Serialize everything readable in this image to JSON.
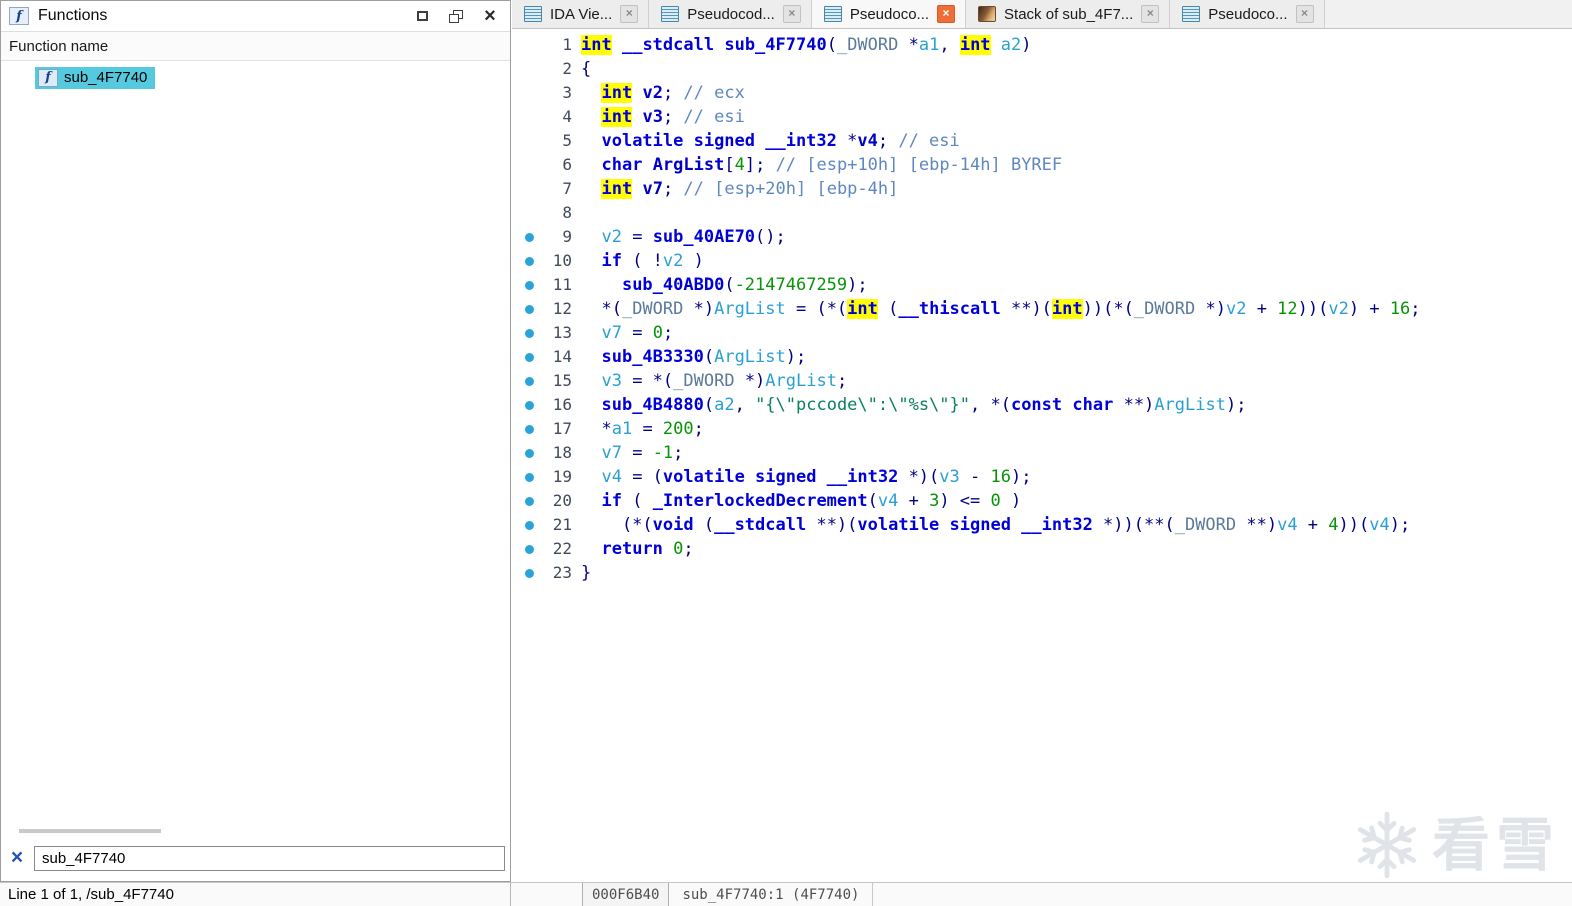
{
  "functions_panel": {
    "title": "Functions",
    "column_header": "Function name",
    "items": [
      {
        "label": "sub_4F7740",
        "selected": true
      }
    ],
    "filter": {
      "value": "sub_4F7740"
    },
    "status": "Line 1 of 1, /sub_4F7740"
  },
  "tabs": [
    {
      "label": "IDA Vie...",
      "active": false,
      "icon": "ida-view-icon"
    },
    {
      "label": "Pseudocod...",
      "active": false,
      "icon": "pseudocode-icon"
    },
    {
      "label": "Pseudoco...",
      "active": true,
      "icon": "pseudocode-icon"
    },
    {
      "label": "Stack of sub_4F7...",
      "active": false,
      "icon": "stack-view-icon"
    },
    {
      "label": "Pseudoco...",
      "active": false,
      "icon": "pseudocode-icon"
    }
  ],
  "status_bar": {
    "address": "000F6B40",
    "location": "sub_4F7740:1 (4F7740)"
  },
  "watermark": {
    "text": "看雪"
  },
  "icons": {
    "function_glyph": "f",
    "close_glyph": "×",
    "clear_filter_glyph": "×"
  },
  "colors": {
    "selection_cyan": "#55cadf",
    "highlight_yellow": "#ffff00",
    "active_close_orange": "#ee6e38",
    "marker_blue": "#2aa3d7",
    "syntax_plain": "#000080",
    "syntax_keyword": "#0000d8",
    "syntax_type": "#5a7a9a",
    "syntax_variable": "#2aa0d0",
    "syntax_declaration": "#0000c8",
    "syntax_function": "#0000d8",
    "syntax_number": "#089408",
    "syntax_string": "#0a8060",
    "syntax_comment": "#5f87c0"
  },
  "code": {
    "lines": [
      {
        "n": 1,
        "m": false,
        "t": [
          [
            "kw",
            "int",
            1
          ],
          [
            "pl",
            " "
          ],
          [
            "kw",
            "__stdcall"
          ],
          [
            "pl",
            " "
          ],
          [
            "fn",
            "sub_4F7740"
          ],
          [
            "pl",
            "("
          ],
          [
            "typ",
            "_DWORD"
          ],
          [
            "pl",
            " *"
          ],
          [
            "var",
            "a1"
          ],
          [
            "pl",
            ", "
          ],
          [
            "kw",
            "int",
            1
          ],
          [
            "pl",
            " "
          ],
          [
            "var",
            "a2"
          ],
          [
            "pl",
            ")"
          ]
        ]
      },
      {
        "n": 2,
        "m": false,
        "t": [
          [
            "pl",
            "{"
          ]
        ]
      },
      {
        "n": 3,
        "m": false,
        "t": [
          [
            "pl",
            "  "
          ],
          [
            "kw",
            "int",
            1
          ],
          [
            "pl",
            " "
          ],
          [
            "decl",
            "v2"
          ],
          [
            "pl",
            "; "
          ],
          [
            "com",
            "// ecx"
          ]
        ]
      },
      {
        "n": 4,
        "m": false,
        "t": [
          [
            "pl",
            "  "
          ],
          [
            "kw",
            "int",
            1
          ],
          [
            "pl",
            " "
          ],
          [
            "decl",
            "v3"
          ],
          [
            "pl",
            "; "
          ],
          [
            "com",
            "// esi"
          ]
        ]
      },
      {
        "n": 5,
        "m": false,
        "t": [
          [
            "pl",
            "  "
          ],
          [
            "kw",
            "volatile signed __int32"
          ],
          [
            "pl",
            " *"
          ],
          [
            "decl",
            "v4"
          ],
          [
            "pl",
            "; "
          ],
          [
            "com",
            "// esi"
          ]
        ]
      },
      {
        "n": 6,
        "m": false,
        "t": [
          [
            "pl",
            "  "
          ],
          [
            "kw",
            "char"
          ],
          [
            "pl",
            " "
          ],
          [
            "decl",
            "ArgList"
          ],
          [
            "pl",
            "["
          ],
          [
            "num",
            "4"
          ],
          [
            "pl",
            "]; "
          ],
          [
            "com",
            "// [esp+10h] [ebp-14h] BYREF"
          ]
        ]
      },
      {
        "n": 7,
        "m": false,
        "t": [
          [
            "pl",
            "  "
          ],
          [
            "kw",
            "int",
            1
          ],
          [
            "pl",
            " "
          ],
          [
            "decl",
            "v7"
          ],
          [
            "pl",
            "; "
          ],
          [
            "com",
            "// [esp+20h] [ebp-4h]"
          ]
        ]
      },
      {
        "n": 8,
        "m": false,
        "t": []
      },
      {
        "n": 9,
        "m": true,
        "t": [
          [
            "pl",
            "  "
          ],
          [
            "var",
            "v2"
          ],
          [
            "pl",
            " = "
          ],
          [
            "fn",
            "sub_40AE70"
          ],
          [
            "pl",
            "();"
          ]
        ]
      },
      {
        "n": 10,
        "m": true,
        "t": [
          [
            "pl",
            "  "
          ],
          [
            "kw",
            "if"
          ],
          [
            "pl",
            " ( !"
          ],
          [
            "var",
            "v2"
          ],
          [
            "pl",
            " )"
          ]
        ]
      },
      {
        "n": 11,
        "m": true,
        "t": [
          [
            "pl",
            "    "
          ],
          [
            "fn",
            "sub_40ABD0"
          ],
          [
            "pl",
            "("
          ],
          [
            "num",
            "-2147467259"
          ],
          [
            "pl",
            ");"
          ]
        ]
      },
      {
        "n": 12,
        "m": true,
        "t": [
          [
            "pl",
            "  *("
          ],
          [
            "typ",
            "_DWORD"
          ],
          [
            "pl",
            " *)"
          ],
          [
            "var",
            "ArgList"
          ],
          [
            "pl",
            " = (*("
          ],
          [
            "kw",
            "int",
            1
          ],
          [
            "pl",
            " ("
          ],
          [
            "kw",
            "__thiscall"
          ],
          [
            "pl",
            " **)("
          ],
          [
            "kw",
            "int",
            1
          ],
          [
            "pl",
            "))(*("
          ],
          [
            "typ",
            "_DWORD"
          ],
          [
            "pl",
            " *)"
          ],
          [
            "var",
            "v2"
          ],
          [
            "pl",
            " + "
          ],
          [
            "num",
            "12"
          ],
          [
            "pl",
            "))("
          ],
          [
            "var",
            "v2"
          ],
          [
            "pl",
            ") + "
          ],
          [
            "num",
            "16"
          ],
          [
            "pl",
            ";"
          ]
        ]
      },
      {
        "n": 13,
        "m": true,
        "t": [
          [
            "pl",
            "  "
          ],
          [
            "var",
            "v7"
          ],
          [
            "pl",
            " = "
          ],
          [
            "num",
            "0"
          ],
          [
            "pl",
            ";"
          ]
        ]
      },
      {
        "n": 14,
        "m": true,
        "t": [
          [
            "pl",
            "  "
          ],
          [
            "fn",
            "sub_4B3330"
          ],
          [
            "pl",
            "("
          ],
          [
            "var",
            "ArgList"
          ],
          [
            "pl",
            ");"
          ]
        ]
      },
      {
        "n": 15,
        "m": true,
        "t": [
          [
            "pl",
            "  "
          ],
          [
            "var",
            "v3"
          ],
          [
            "pl",
            " = *("
          ],
          [
            "typ",
            "_DWORD"
          ],
          [
            "pl",
            " *)"
          ],
          [
            "var",
            "ArgList"
          ],
          [
            "pl",
            ";"
          ]
        ]
      },
      {
        "n": 16,
        "m": true,
        "t": [
          [
            "pl",
            "  "
          ],
          [
            "fn",
            "sub_4B4880"
          ],
          [
            "pl",
            "("
          ],
          [
            "var",
            "a2"
          ],
          [
            "pl",
            ", "
          ],
          [
            "str",
            "\"{\\\"pccode\\\":\\\"%s\\\"}\""
          ],
          [
            "pl",
            ", *("
          ],
          [
            "kw",
            "const"
          ],
          [
            "pl",
            " "
          ],
          [
            "kw",
            "char"
          ],
          [
            "pl",
            " **)"
          ],
          [
            "var",
            "ArgList"
          ],
          [
            "pl",
            ");"
          ]
        ]
      },
      {
        "n": 17,
        "m": true,
        "t": [
          [
            "pl",
            "  *"
          ],
          [
            "var",
            "a1"
          ],
          [
            "pl",
            " = "
          ],
          [
            "num",
            "200"
          ],
          [
            "pl",
            ";"
          ]
        ]
      },
      {
        "n": 18,
        "m": true,
        "t": [
          [
            "pl",
            "  "
          ],
          [
            "var",
            "v7"
          ],
          [
            "pl",
            " = "
          ],
          [
            "num",
            "-1"
          ],
          [
            "pl",
            ";"
          ]
        ]
      },
      {
        "n": 19,
        "m": true,
        "t": [
          [
            "pl",
            "  "
          ],
          [
            "var",
            "v4"
          ],
          [
            "pl",
            " = ("
          ],
          [
            "kw",
            "volatile signed __int32"
          ],
          [
            "pl",
            " *)("
          ],
          [
            "var",
            "v3"
          ],
          [
            "pl",
            " - "
          ],
          [
            "num",
            "16"
          ],
          [
            "pl",
            ");"
          ]
        ]
      },
      {
        "n": 20,
        "m": true,
        "t": [
          [
            "pl",
            "  "
          ],
          [
            "kw",
            "if"
          ],
          [
            "pl",
            " ( "
          ],
          [
            "fn",
            "_InterlockedDecrement"
          ],
          [
            "pl",
            "("
          ],
          [
            "var",
            "v4"
          ],
          [
            "pl",
            " + "
          ],
          [
            "num",
            "3"
          ],
          [
            "pl",
            ") <= "
          ],
          [
            "num",
            "0"
          ],
          [
            "pl",
            " )"
          ]
        ]
      },
      {
        "n": 21,
        "m": true,
        "t": [
          [
            "pl",
            "    (*("
          ],
          [
            "kw",
            "void"
          ],
          [
            "pl",
            " ("
          ],
          [
            "kw",
            "__stdcall"
          ],
          [
            "pl",
            " **)("
          ],
          [
            "kw",
            "volatile signed __int32"
          ],
          [
            "pl",
            " *))(**("
          ],
          [
            "typ",
            "_DWORD"
          ],
          [
            "pl",
            " **)"
          ],
          [
            "var",
            "v4"
          ],
          [
            "pl",
            " + "
          ],
          [
            "num",
            "4"
          ],
          [
            "pl",
            "))("
          ],
          [
            "var",
            "v4"
          ],
          [
            "pl",
            ");"
          ]
        ]
      },
      {
        "n": 22,
        "m": true,
        "t": [
          [
            "pl",
            "  "
          ],
          [
            "kw",
            "return"
          ],
          [
            "pl",
            " "
          ],
          [
            "num",
            "0"
          ],
          [
            "pl",
            ";"
          ]
        ]
      },
      {
        "n": 23,
        "m": true,
        "t": [
          [
            "pl",
            "}"
          ]
        ]
      }
    ]
  }
}
